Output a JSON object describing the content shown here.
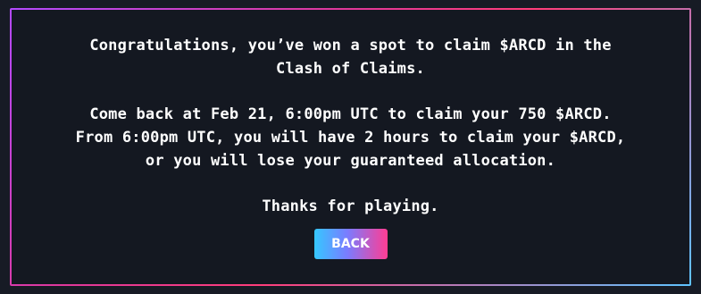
{
  "dialog": {
    "paragraphs": [
      [
        "Congratulations, you’ve won a spot to claim $ARCD in the",
        "Clash of Claims."
      ],
      [
        "Come back at Feb 21, 6:00pm UTC to claim your 750 $ARCD.",
        "From 6:00pm UTC, you will have 2 hours to claim your $ARCD,",
        "or you will lose your guaranteed allocation."
      ],
      [
        "Thanks for playing."
      ]
    ],
    "back_label": "BACK"
  },
  "colors": {
    "background": "#171b25",
    "panel": "#141821",
    "text": "#ffffff",
    "accent_pink": "#ff3d93",
    "accent_blue": "#35c8ff",
    "accent_purple": "#b34aff"
  }
}
